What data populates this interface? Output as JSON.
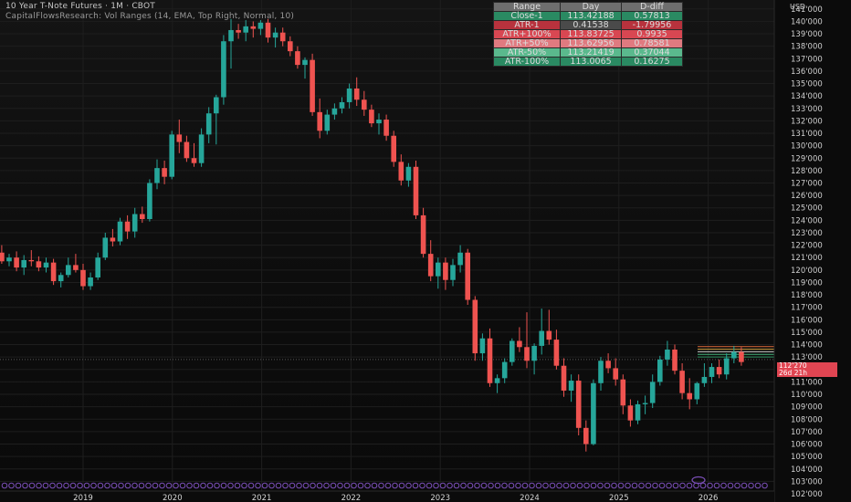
{
  "header": {
    "symbol": "10 Year T-Note Futures · 1M · CBOT",
    "indicator": "CapitalFlowsResearch: Vol Ranges (14, EMA, Top Right, Normal, 10)"
  },
  "price_axis": {
    "currency": "USD",
    "last_price": "112'270",
    "countdown": "26d 21h",
    "ticks": [
      "141'000",
      "140'000",
      "139'000",
      "138'000",
      "137'000",
      "136'000",
      "135'000",
      "134'000",
      "133'000",
      "132'000",
      "131'000",
      "130'000",
      "129'000",
      "128'000",
      "127'000",
      "126'000",
      "125'000",
      "124'000",
      "123'000",
      "122'000",
      "121'000",
      "120'000",
      "119'000",
      "118'000",
      "117'000",
      "116'000",
      "115'000",
      "114'000",
      "113'000",
      "112'000",
      "111'000",
      "110'000",
      "109'000",
      "108'000",
      "107'000",
      "106'000",
      "105'000",
      "104'000",
      "103'000",
      "102'000"
    ]
  },
  "range_table": {
    "headers": [
      "Range",
      "Day",
      "D-diff"
    ],
    "rows": [
      {
        "label": "Close-1",
        "day": "113.42188",
        "diff": "0.57813",
        "color": "#2a8a62"
      },
      {
        "label": "ATR-1",
        "day": "0.41538",
        "diff": "-1.79956",
        "color": "#b8323d"
      },
      {
        "label": "ATR+100%",
        "day": "113.83725",
        "diff": "0.9935",
        "color": "#d84752"
      },
      {
        "label": "ATR+50%",
        "day": "113.62956",
        "diff": "0.78581",
        "color": "#e07a80"
      },
      {
        "label": "ATR-50%",
        "day": "113.21419",
        "diff": "0.37044",
        "color": "#5ab98d"
      },
      {
        "label": "ATR-100%",
        "day": "113.0065",
        "diff": "0.16275",
        "color": "#2a8a62"
      }
    ],
    "header_color": "#6e6e6e"
  },
  "colors": {
    "up": "#26a69a",
    "down": "#ef5350",
    "grid": "#1e1e1e",
    "marker": "#7b4fb8"
  },
  "chart_data": {
    "type": "candlestick",
    "x_labels": [
      "2019",
      "2020",
      "2021",
      "2022",
      "2023",
      "2024",
      "2025",
      "2026"
    ],
    "ylim": [
      102.0,
      141.5
    ],
    "start": "2018-02",
    "ohlc": [
      [
        121.4,
        122.0,
        120.5,
        120.7
      ],
      [
        120.7,
        121.3,
        120.3,
        121.0
      ],
      [
        121.0,
        121.5,
        119.9,
        120.2
      ],
      [
        120.2,
        121.2,
        119.6,
        120.8
      ],
      [
        120.8,
        121.6,
        120.3,
        120.7
      ],
      [
        120.7,
        121.1,
        119.9,
        120.2
      ],
      [
        120.2,
        121.0,
        119.8,
        120.6
      ],
      [
        120.6,
        120.9,
        118.8,
        119.1
      ],
      [
        119.1,
        119.8,
        118.6,
        119.6
      ],
      [
        119.6,
        121.0,
        119.4,
        120.4
      ],
      [
        120.4,
        121.3,
        119.8,
        120.0
      ],
      [
        120.0,
        120.5,
        118.4,
        118.7
      ],
      [
        118.7,
        119.8,
        118.4,
        119.4
      ],
      [
        119.4,
        121.4,
        119.2,
        121.0
      ],
      [
        121.0,
        123.0,
        120.8,
        122.6
      ],
      [
        122.6,
        123.3,
        121.9,
        122.3
      ],
      [
        122.3,
        124.2,
        122.0,
        123.9
      ],
      [
        123.9,
        124.4,
        122.5,
        123.1
      ],
      [
        123.1,
        125.0,
        122.6,
        124.5
      ],
      [
        124.5,
        125.1,
        123.8,
        124.1
      ],
      [
        124.1,
        127.3,
        123.9,
        127.0
      ],
      [
        127.0,
        128.9,
        126.5,
        128.2
      ],
      [
        128.2,
        128.8,
        126.9,
        127.5
      ],
      [
        127.5,
        131.2,
        127.3,
        130.9
      ],
      [
        130.9,
        132.1,
        129.4,
        130.3
      ],
      [
        130.3,
        130.8,
        128.7,
        129.0
      ],
      [
        129.0,
        130.2,
        128.3,
        128.6
      ],
      [
        128.6,
        131.4,
        128.3,
        130.9
      ],
      [
        130.9,
        133.1,
        130.2,
        132.6
      ],
      [
        132.6,
        134.1,
        130.1,
        133.9
      ],
      [
        133.9,
        138.9,
        133.3,
        138.4
      ],
      [
        138.4,
        140.2,
        136.2,
        139.3
      ],
      [
        139.3,
        139.8,
        138.6,
        139.1
      ],
      [
        139.1,
        140.1,
        138.4,
        139.6
      ],
      [
        139.6,
        140.0,
        138.7,
        139.4
      ],
      [
        139.4,
        140.1,
        138.9,
        139.9
      ],
      [
        139.9,
        140.2,
        138.3,
        138.7
      ],
      [
        138.7,
        139.5,
        137.9,
        139.1
      ],
      [
        139.1,
        139.5,
        138.0,
        138.4
      ],
      [
        138.4,
        138.8,
        137.2,
        137.6
      ],
      [
        137.6,
        138.0,
        136.2,
        136.5
      ],
      [
        136.5,
        137.1,
        135.4,
        136.9
      ],
      [
        136.9,
        137.4,
        132.4,
        132.7
      ],
      [
        132.7,
        133.8,
        130.6,
        131.2
      ],
      [
        131.2,
        132.9,
        130.9,
        132.5
      ],
      [
        132.5,
        133.4,
        132.1,
        133.0
      ],
      [
        133.0,
        133.9,
        132.6,
        133.5
      ],
      [
        133.5,
        135.0,
        133.0,
        134.6
      ],
      [
        134.6,
        135.5,
        133.2,
        133.7
      ],
      [
        133.7,
        134.4,
        132.4,
        132.9
      ],
      [
        132.9,
        133.3,
        131.5,
        131.8
      ],
      [
        131.8,
        132.6,
        130.9,
        132.1
      ],
      [
        132.1,
        132.5,
        130.4,
        130.8
      ],
      [
        130.8,
        131.2,
        128.3,
        128.7
      ],
      [
        128.7,
        129.3,
        126.8,
        127.2
      ],
      [
        127.2,
        128.6,
        126.7,
        128.3
      ],
      [
        128.3,
        128.8,
        124.1,
        124.4
      ],
      [
        124.4,
        125.0,
        121.0,
        121.3
      ],
      [
        121.3,
        122.4,
        119.1,
        119.5
      ],
      [
        119.5,
        121.0,
        118.5,
        120.6
      ],
      [
        120.6,
        121.0,
        118.4,
        119.2
      ],
      [
        119.2,
        120.9,
        118.7,
        120.4
      ],
      [
        120.4,
        122.0,
        119.8,
        121.4
      ],
      [
        121.4,
        121.7,
        117.2,
        117.6
      ],
      [
        117.6,
        117.9,
        112.7,
        113.3
      ],
      [
        113.3,
        114.9,
        112.7,
        114.5
      ],
      [
        114.5,
        115.3,
        110.6,
        110.9
      ],
      [
        110.9,
        111.6,
        110.1,
        111.3
      ],
      [
        111.3,
        112.9,
        110.9,
        112.6
      ],
      [
        112.6,
        114.5,
        112.3,
        114.3
      ],
      [
        114.3,
        115.4,
        113.4,
        113.8
      ],
      [
        113.8,
        116.6,
        112.1,
        112.7
      ],
      [
        112.7,
        114.1,
        111.6,
        113.9
      ],
      [
        113.9,
        116.9,
        113.2,
        115.1
      ],
      [
        115.1,
        116.8,
        114.0,
        114.4
      ],
      [
        114.4,
        115.2,
        112.0,
        112.3
      ],
      [
        112.3,
        112.9,
        109.8,
        110.3
      ],
      [
        110.3,
        111.6,
        109.4,
        111.1
      ],
      [
        111.1,
        111.6,
        106.7,
        107.3
      ],
      [
        107.3,
        107.9,
        105.4,
        106.0
      ],
      [
        106.0,
        111.2,
        105.9,
        110.9
      ],
      [
        110.9,
        113.0,
        110.3,
        112.7
      ],
      [
        112.7,
        113.3,
        111.7,
        112.1
      ],
      [
        112.1,
        112.9,
        110.7,
        111.2
      ],
      [
        111.2,
        111.6,
        108.4,
        109.1
      ],
      [
        109.1,
        109.6,
        107.4,
        107.9
      ],
      [
        107.9,
        109.5,
        107.6,
        109.2
      ],
      [
        109.2,
        109.9,
        108.4,
        109.3
      ],
      [
        109.3,
        111.6,
        108.9,
        111.0
      ],
      [
        111.0,
        113.1,
        110.7,
        112.8
      ],
      [
        112.8,
        114.3,
        112.3,
        113.6
      ],
      [
        113.6,
        114.0,
        111.6,
        111.9
      ],
      [
        111.9,
        112.5,
        109.6,
        110.1
      ],
      [
        110.1,
        111.3,
        108.8,
        109.6
      ],
      [
        109.6,
        111.0,
        109.2,
        110.9
      ],
      [
        110.9,
        112.5,
        110.6,
        111.4
      ],
      [
        111.4,
        112.5,
        110.9,
        112.2
      ],
      [
        112.2,
        112.8,
        111.3,
        111.6
      ],
      [
        111.6,
        113.3,
        111.2,
        112.9
      ],
      [
        112.9,
        113.9,
        112.5,
        113.4
      ],
      [
        113.4,
        113.8,
        112.3,
        112.6
      ]
    ],
    "reference_lines": [
      113.837,
      113.63,
      113.422,
      113.214,
      113.007
    ]
  }
}
